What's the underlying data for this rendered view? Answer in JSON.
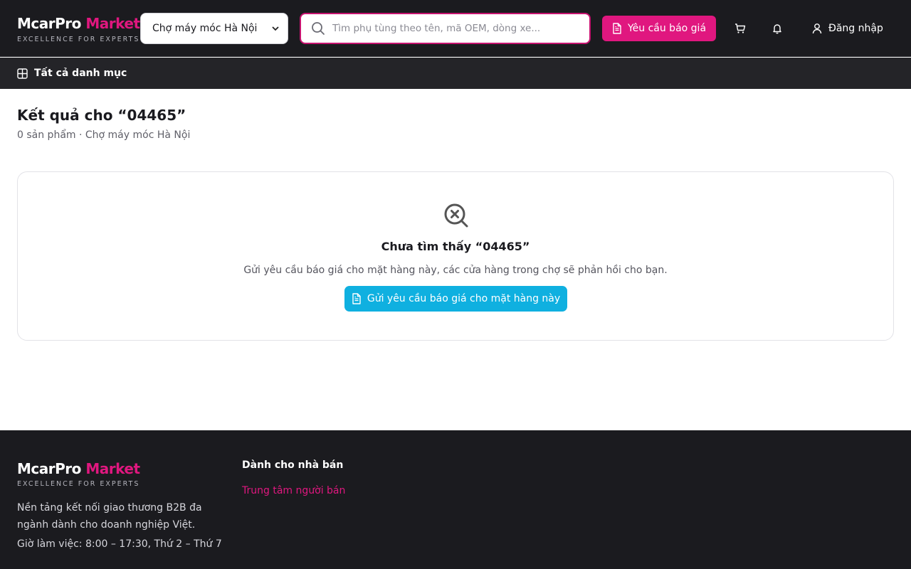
{
  "header": {
    "brand_main": "McarPro",
    "brand_accent": "Market",
    "tagline": "EXCELLENCE FOR EXPERTS",
    "market_select": {
      "value": "Chợ máy móc Hà Nội"
    },
    "search": {
      "placeholder": "Tìm phụ tùng theo tên, mã OEM, dòng xe..."
    },
    "quote_button": "Yêu cầu báo giá",
    "cart_icon": "cart-icon",
    "bell_icon": "bell-icon",
    "login_label": "Đăng nhập"
  },
  "category_bar": {
    "label": "Tất cả danh mục"
  },
  "results": {
    "title": "Kết quả cho “04465”",
    "subtitle": "0 sản phẩm · Chợ máy móc Hà Nội"
  },
  "empty_state": {
    "title": "Chưa tìm thấy “04465”",
    "description": "Gửi yêu cầu báo giá cho mặt hàng này, các cửa hàng trong chợ sẽ phản hồi cho bạn.",
    "button": "Gửi yêu cầu báo giá cho mặt hàng này"
  },
  "footer": {
    "brand_main": "McarPro",
    "brand_accent": "Market",
    "tagline": "EXCELLENCE FOR EXPERTS",
    "description": "Nền tảng kết nối giao thương B2B đa ngành dành cho doanh nghiệp Việt.",
    "hours": "Giờ làm việc: 8:00 – 17:30, Thứ 2 – Thứ 7",
    "seller_title": "Dành cho nhà bán",
    "seller_link": "Trung tâm người bán"
  },
  "colors": {
    "accent": "#e0177f",
    "secondary": "#0fb0e0",
    "dark": "#1b1b1f"
  }
}
